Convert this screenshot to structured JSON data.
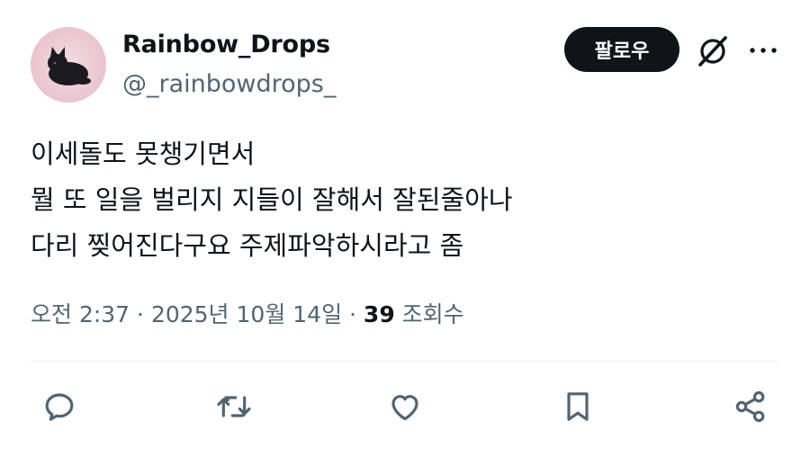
{
  "user": {
    "display_name": "Rainbow_Drops",
    "handle": "@_rainbowdrops_"
  },
  "follow_label": "팔로우",
  "tweet": {
    "lines": [
      "이세돌도 못챙기면서",
      "뭘 또 일을 벌리지 지들이 잘해서 잘된줄아나",
      "다리 찢어진다구요 주제파악하시라고 좀"
    ]
  },
  "meta": {
    "time": "오전 2:37",
    "sep1": " · ",
    "date": "2025년 10월 14일",
    "sep2": " · ",
    "views_count": "39",
    "views_label": " 조회수"
  },
  "icons": {
    "reply": "reply-icon",
    "retweet": "retweet-icon",
    "like": "like-icon",
    "bookmark": "bookmark-icon",
    "share": "share-icon",
    "grok": "grok-icon",
    "more": "more-icon"
  },
  "colors": {
    "text": "#0f1419",
    "secondary": "#536471",
    "button_bg": "#0f1419"
  }
}
